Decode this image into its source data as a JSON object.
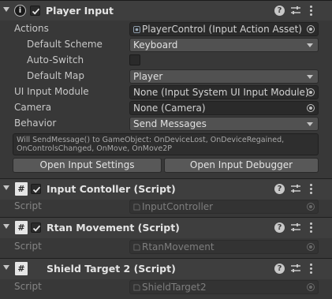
{
  "player_input": {
    "title": "Player Input",
    "enabled": true,
    "actions_label": "Actions",
    "actions_value": "PlayerControl (Input Action Asset)",
    "default_scheme_label": "Default Scheme",
    "default_scheme_value": "Keyboard",
    "auto_switch_label": "Auto-Switch",
    "auto_switch_checked": false,
    "default_map_label": "Default Map",
    "default_map_value": "Player",
    "ui_input_module_label": "UI Input Module",
    "ui_input_module_value": "None (Input System UI Input Module)",
    "camera_label": "Camera",
    "camera_value": "None (Camera)",
    "behavior_label": "Behavior",
    "behavior_value": "Send Messages",
    "info_line1": "Will SendMessage() to GameObject: OnDeviceLost, OnDeviceRegained,",
    "info_line2": "OnControlsChanged, OnMove, OnMove2P",
    "open_settings_label": "Open Input Settings",
    "open_debugger_label": "Open Input Debugger"
  },
  "components": [
    {
      "title": "Input Contoller (Script)",
      "has_checkbox": true,
      "script_label": "Script",
      "script_value": "InputController"
    },
    {
      "title": "Rtan Movement (Script)",
      "has_checkbox": true,
      "script_label": "Script",
      "script_value": "RtanMovement"
    },
    {
      "title": "Shield Target 2 (Script)",
      "has_checkbox": false,
      "script_label": "Script",
      "script_value": "ShieldTarget2"
    }
  ],
  "icons": {
    "header_fold": "triangle-down-icon",
    "help": "help-icon",
    "presets": "presets-icon",
    "menu": "kebab-menu-icon",
    "script": "script-hash-icon",
    "object_picker": "object-picker-icon",
    "dropdown": "dropdown-arrow-icon",
    "player_input_component": "info-icon"
  },
  "colors": {
    "background": "#383838",
    "header": "#3e3e3e",
    "field": "#2a2a2a",
    "dropdown": "#515151",
    "button": "#585858",
    "text": "#d2d2d2"
  }
}
